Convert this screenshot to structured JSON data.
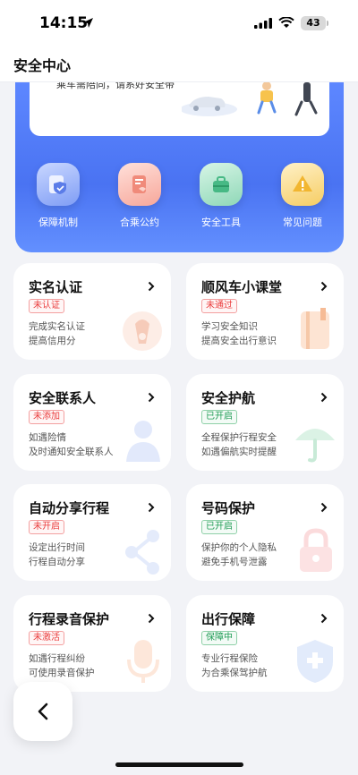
{
  "status_bar": {
    "time": "14:15",
    "battery": "43"
  },
  "header": {
    "title": "安全中心"
  },
  "banner": {
    "text": "乘车需陪同，请系好安全带"
  },
  "quick_actions": [
    {
      "label": "保障机制",
      "icon": "shield-doc-icon"
    },
    {
      "label": "合乘公约",
      "icon": "handshake-doc-icon"
    },
    {
      "label": "安全工具",
      "icon": "toolbox-icon"
    },
    {
      "label": "常见问题",
      "icon": "warning-icon"
    }
  ],
  "cards": [
    {
      "title": "实名认证",
      "badge": "未认证",
      "badge_type": "red",
      "desc1": "完成实名认证",
      "desc2": "提高信用分"
    },
    {
      "title": "顺风车小课堂",
      "badge": "未通过",
      "badge_type": "red",
      "desc1": "学习安全知识",
      "desc2": "提高安全出行意识"
    },
    {
      "title": "安全联系人",
      "badge": "未添加",
      "badge_type": "red",
      "desc1": "如遇险情",
      "desc2": "及时通知安全联系人"
    },
    {
      "title": "安全护航",
      "badge": "已开启",
      "badge_type": "green",
      "desc1": "全程保护行程安全",
      "desc2": "如遇偏航实时提醒"
    },
    {
      "title": "自动分享行程",
      "badge": "未开启",
      "badge_type": "red",
      "desc1": "设定出行时间",
      "desc2": "行程自动分享"
    },
    {
      "title": "号码保护",
      "badge": "已开启",
      "badge_type": "green",
      "desc1": "保护你的个人隐私",
      "desc2": "避免手机号泄露"
    },
    {
      "title": "行程录音保护",
      "badge": "未激活",
      "badge_type": "red",
      "desc1": "如遇行程纠纷",
      "desc2": "可使用录音保护"
    },
    {
      "title": "出行保障",
      "badge": "保障中",
      "badge_type": "green",
      "desc1": "专业行程保险",
      "desc2": "为合乘保驾护航"
    }
  ],
  "colors": {
    "accent_blue": "#4a73f2",
    "danger_red": "#ea3b3b",
    "success_green": "#1e9b54"
  }
}
